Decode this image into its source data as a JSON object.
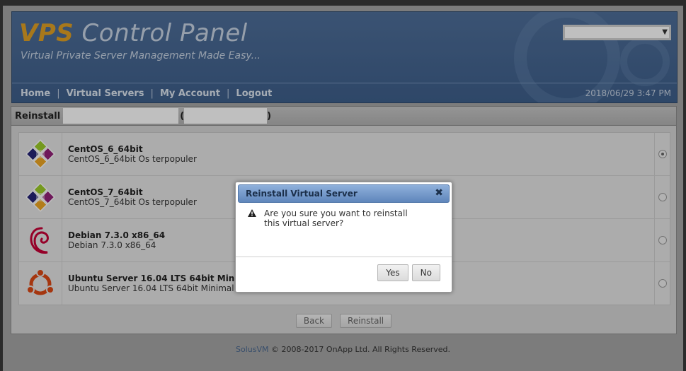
{
  "header": {
    "brand_vps": "VPS",
    "brand_rest": " Control Panel",
    "tagline": "Virtual Private Server Management Made Easy...",
    "nav": [
      "Home",
      "Virtual Servers",
      "My Account",
      "Logout"
    ],
    "datetime": "2018/06/29 3:47 PM"
  },
  "panel": {
    "title": "Reinstall",
    "paren_open": "(",
    "paren_close": ")",
    "os_list": [
      {
        "name": "CentOS_6_64bit",
        "desc": "CentOS_6_64bit Os terpopuler",
        "icon": "centos-icon",
        "selected": true
      },
      {
        "name": "CentOS_7_64bit",
        "desc": "CentOS_7_64bit Os terpopuler",
        "icon": "centos-icon",
        "selected": false
      },
      {
        "name": "Debian 7.3.0 x86_64",
        "desc": "Debian 7.3.0 x86_64",
        "icon": "debian-icon",
        "selected": false
      },
      {
        "name": "Ubuntu Server 16.04 LTS 64bit Minimal",
        "desc": "Ubuntu Server 16.04 LTS 64bit Minimal",
        "icon": "ubuntu-icon",
        "selected": false
      }
    ],
    "back_label": "Back",
    "reinstall_label": "Reinstall"
  },
  "footer": {
    "brand": "SolusVM",
    "text": " © 2008-2017 OnApp Ltd. All Rights Reserved."
  },
  "dialog": {
    "title": "Reinstall Virtual Server",
    "message": "Are you sure you want to reinstall this virtual server?",
    "yes_label": "Yes",
    "no_label": "No"
  },
  "colors": {
    "header_bg": "#4a6a96",
    "accent_orange": "#e0a025",
    "dialog_title": "#6f94c6"
  }
}
